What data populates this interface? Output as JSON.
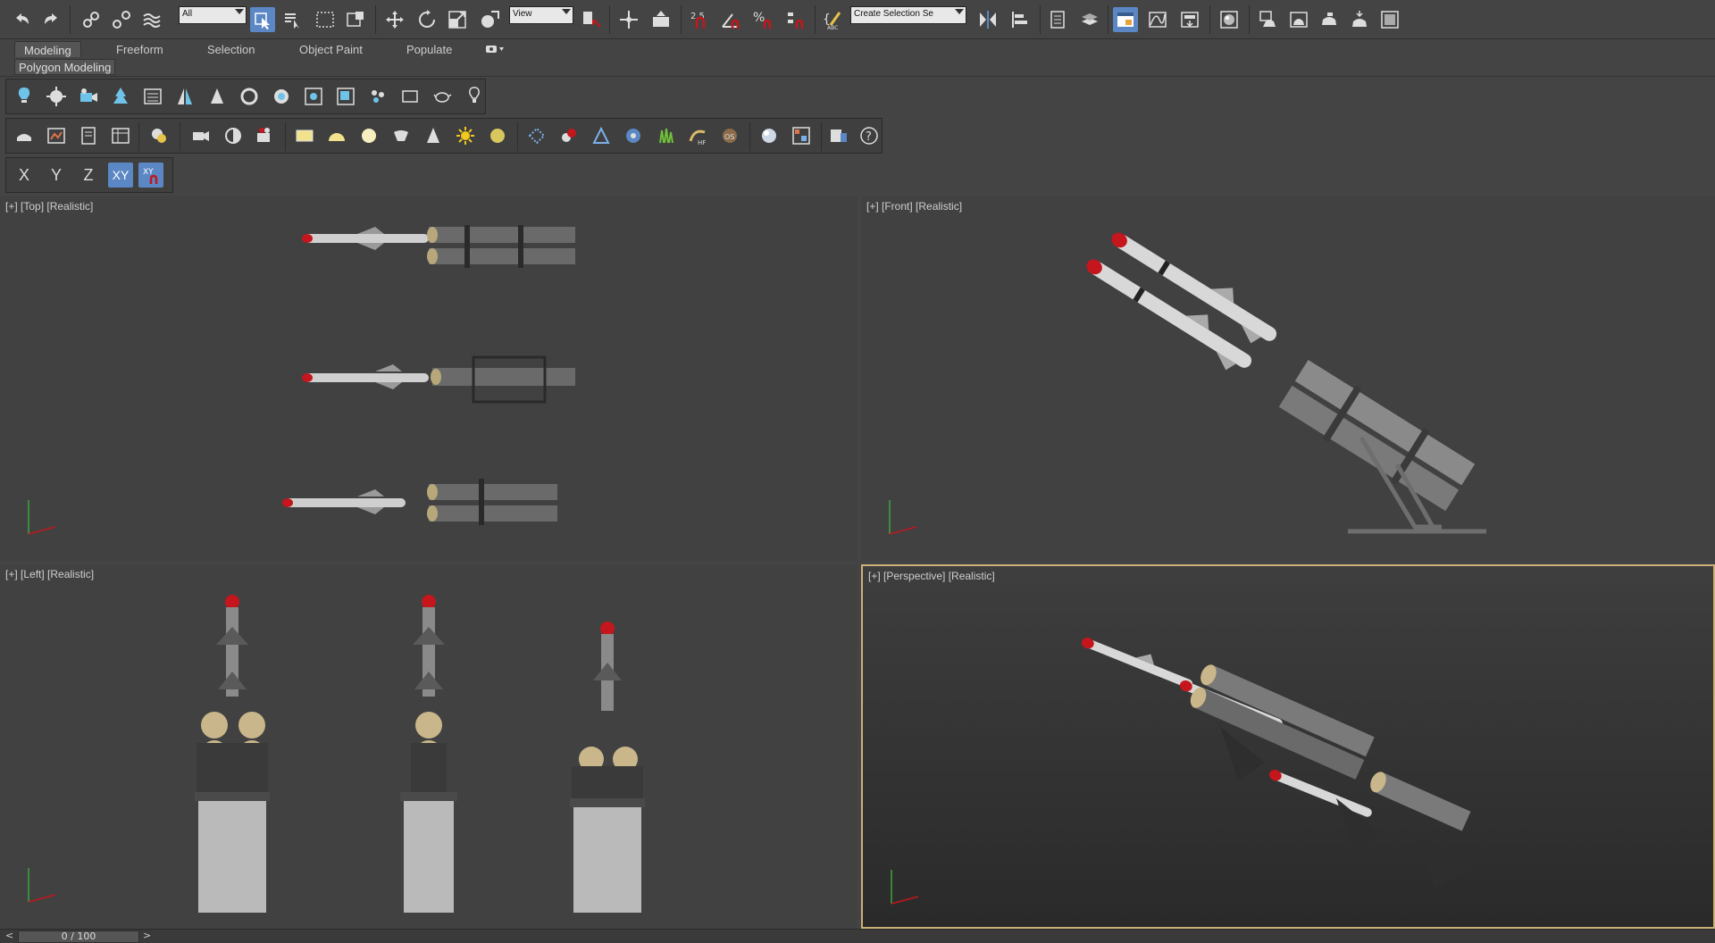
{
  "toolbar": {
    "selection_filter": "All",
    "reference_coord": "View",
    "snap_angle": "2.5",
    "named_selection_placeholder": "Create Selection Se"
  },
  "ribbon": {
    "tabs": [
      {
        "label": "Modeling",
        "active": true
      },
      {
        "label": "Freeform"
      },
      {
        "label": "Selection"
      },
      {
        "label": "Object Paint"
      },
      {
        "label": "Populate"
      }
    ],
    "panel": "Polygon Modeling"
  },
  "axis_constraints": [
    "X",
    "Y",
    "Z",
    "XY"
  ],
  "viewports": [
    {
      "label": "[+] [Top] [Realistic]"
    },
    {
      "label": "[+] [Front] [Realistic]"
    },
    {
      "label": "[+] [Left] [Realistic]"
    },
    {
      "label": "[+] [Perspective] [Realistic]",
      "active": true
    }
  ],
  "timeline": {
    "frame_display": "0 / 100",
    "prev": "<",
    "next": ">"
  },
  "colors": {
    "active_blue": "#5b87c4",
    "active_border": "#cbb078",
    "missile_tip": "#c4161c"
  }
}
